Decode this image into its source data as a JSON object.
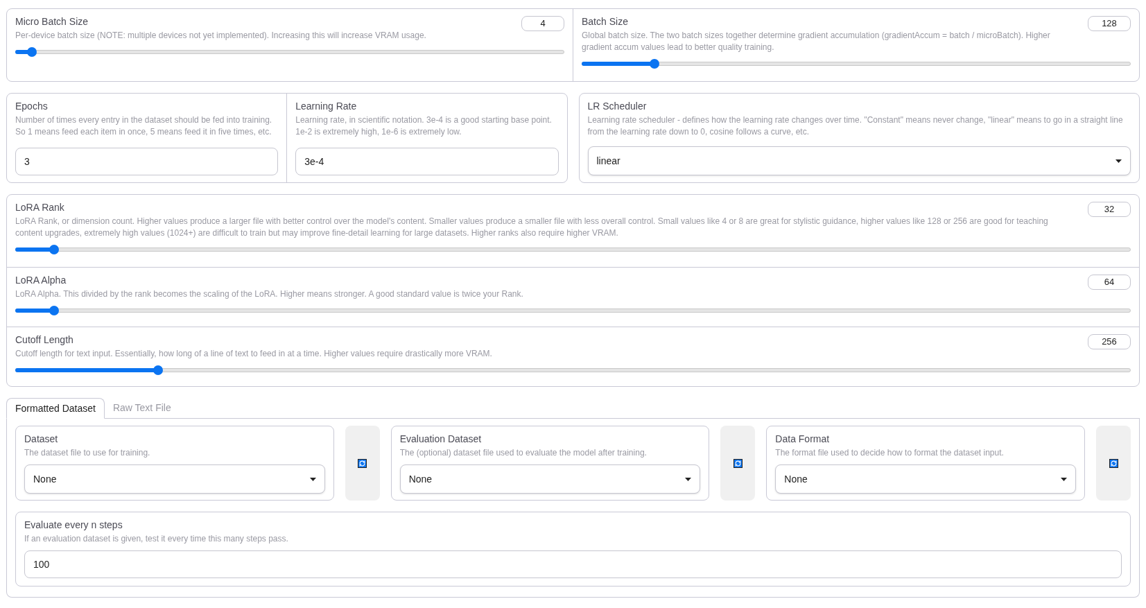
{
  "batch_settings": [
    {
      "label": "Micro Batch Size",
      "description": "Per-device batch size (NOTE: multiple devices not yet implemented). Increasing this will increase VRAM usage.",
      "value": "4",
      "level": 0.03
    },
    {
      "label": "Batch Size",
      "description": "Global batch size. The two batch sizes together determine gradient accumulation (gradientAccum = batch / microBatch). Higher gradient accum values lead to better quality training.",
      "value": "128",
      "level": 0.133
    }
  ],
  "training_groups": [
    [
      {
        "kind": "text",
        "label": "Epochs",
        "description": "Number of times every entry in the dataset should be fed into training. So 1 means feed each item in once, 5 means feed it in five times, etc.",
        "value": "3"
      },
      {
        "kind": "text",
        "label": "Learning Rate",
        "description": "Learning rate, in scientific notation. 3e-4 is a good starting base point. 1e-2 is extremely high, 1e-6 is extremely low.",
        "value": "3e-4"
      }
    ],
    [
      {
        "kind": "select",
        "label": "LR Scheduler",
        "description": "Learning rate scheduler - defines how the learning rate changes over time. \"Constant\" means never change, \"linear\" means to go in a straight line from the learning rate down to 0, cosine follows a curve, etc.",
        "value": "linear"
      }
    ]
  ],
  "lora_settings": [
    {
      "label": "LoRA Rank",
      "description": "LoRA Rank, or dimension count. Higher values produce a larger file with better control over the model's content. Smaller values produce a smaller file with less overall control. Small values like 4 or 8 are great for stylistic guidance, higher values like 128 or 256 are good for teaching content upgrades, extremely high values (1024+) are difficult to train but may improve fine-detail learning for large datasets. Higher ranks also require higher VRAM.",
      "value": "32",
      "level": 0.035
    },
    {
      "label": "LoRA Alpha",
      "description": "LoRA Alpha. This divided by the rank becomes the scaling of the LoRA. Higher means stronger. A good standard value is twice your Rank.",
      "value": "64",
      "level": 0.035
    },
    {
      "label": "Cutoff Length",
      "description": "Cutoff length for text input. Essentially, how long of a line of text to feed in at a time. Higher values require drastically more VRAM.",
      "value": "256",
      "level": 0.128
    }
  ],
  "tabs": [
    {
      "label": "Formatted Dataset",
      "selected": true
    },
    {
      "label": "Raw Text File",
      "selected": false
    }
  ],
  "dataset_fields": [
    {
      "label": "Dataset",
      "description": "The dataset file to use for training.",
      "value": "None"
    },
    {
      "label": "Evaluation Dataset",
      "description": "The (optional) dataset file used to evaluate the model after training.",
      "value": "None"
    },
    {
      "label": "Data Format",
      "description": "The format file used to decide how to format the dataset input.",
      "value": "None"
    }
  ],
  "eval_steps": {
    "label": "Evaluate every n steps",
    "description": "If an evaluation dataset is given, test it every time this many steps pass.",
    "value": "100"
  }
}
